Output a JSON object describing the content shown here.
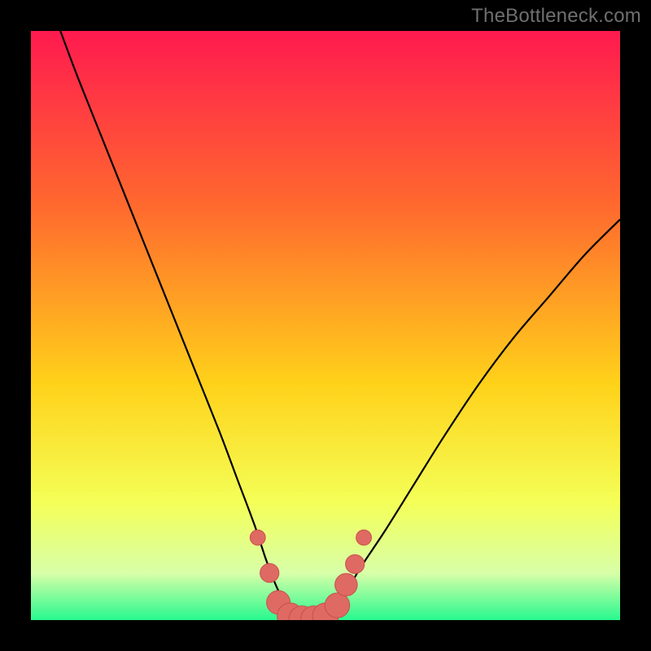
{
  "watermark": "TheBottleneck.com",
  "colors": {
    "frame": "#000000",
    "gradient_top": "#ff1a4f",
    "gradient_mid1": "#ff6a2e",
    "gradient_mid2": "#ffd21a",
    "gradient_low1": "#f4ff57",
    "gradient_low2": "#d8ffa8",
    "gradient_bottom": "#28f98f",
    "curve": "#000000",
    "markers_fill": "#de6a63",
    "markers_stroke": "#c94f4a"
  },
  "chart_data": {
    "type": "line",
    "title": "",
    "xlabel": "",
    "ylabel": "",
    "xlim": [
      0,
      100
    ],
    "ylim": [
      0,
      100
    ],
    "series": [
      {
        "name": "bottleneck-curve",
        "x": [
          5,
          8,
          12,
          16,
          20,
          24,
          28,
          32,
          35,
          38,
          40,
          42,
          44,
          46,
          48,
          50,
          53,
          56,
          60,
          65,
          70,
          76,
          82,
          88,
          94,
          100
        ],
        "y": [
          100,
          92,
          82,
          72,
          62,
          52,
          42,
          32,
          24,
          16,
          10,
          5,
          2,
          0,
          0,
          1,
          4,
          9,
          15,
          23,
          31,
          40,
          48,
          55,
          62,
          68
        ]
      }
    ],
    "markers": [
      {
        "x": 38.5,
        "y": 14,
        "r": 1.3
      },
      {
        "x": 40.5,
        "y": 8,
        "r": 1.6
      },
      {
        "x": 42.0,
        "y": 3,
        "r": 2.0
      },
      {
        "x": 44.0,
        "y": 0.7,
        "r": 2.2
      },
      {
        "x": 46.0,
        "y": 0.2,
        "r": 2.2
      },
      {
        "x": 48.0,
        "y": 0.2,
        "r": 2.2
      },
      {
        "x": 50.0,
        "y": 0.7,
        "r": 2.2
      },
      {
        "x": 52.0,
        "y": 2.5,
        "r": 2.1
      },
      {
        "x": 53.5,
        "y": 6,
        "r": 1.9
      },
      {
        "x": 55.0,
        "y": 9.5,
        "r": 1.6
      },
      {
        "x": 56.5,
        "y": 14,
        "r": 1.3
      }
    ],
    "gradient_stops": [
      {
        "offset": 0.0,
        "key": "gradient_top"
      },
      {
        "offset": 0.3,
        "key": "gradient_mid1"
      },
      {
        "offset": 0.6,
        "key": "gradient_mid2"
      },
      {
        "offset": 0.8,
        "key": "gradient_low1"
      },
      {
        "offset": 0.92,
        "key": "gradient_low2"
      },
      {
        "offset": 1.0,
        "key": "gradient_bottom"
      }
    ]
  }
}
